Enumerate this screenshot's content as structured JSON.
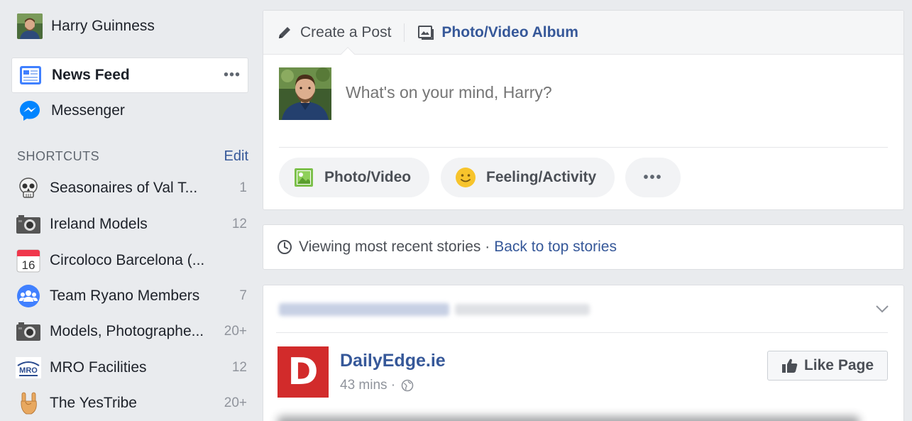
{
  "sidebar": {
    "profile_name": "Harry Guinness",
    "nav": [
      {
        "label": "News Feed",
        "icon": "news-feed-icon"
      },
      {
        "label": "Messenger",
        "icon": "messenger-icon"
      }
    ],
    "more_label": "•••",
    "shortcuts_title": "SHORTCUTS",
    "shortcuts_edit": "Edit",
    "shortcuts": [
      {
        "label": "Seasonaires of Val T...",
        "count": "1",
        "icon": "skull-icon"
      },
      {
        "label": "Ireland Models",
        "count": "12",
        "icon": "camera-icon"
      },
      {
        "label": "Circoloco Barcelona (...",
        "count": "",
        "icon": "calendar-icon",
        "calendar_day": "16"
      },
      {
        "label": "Team Ryano Members",
        "count": "7",
        "icon": "group-icon"
      },
      {
        "label": "Models, Photographe...",
        "count": "20+",
        "icon": "camera-icon"
      },
      {
        "label": "MRO Facilities",
        "count": "12",
        "icon": "mro-logo-icon",
        "logo_text": "MRO"
      },
      {
        "label": "The YesTribe",
        "count": "20+",
        "icon": "rock-hand-icon"
      }
    ]
  },
  "composer": {
    "tab_create": "Create a Post",
    "tab_album": "Photo/Video Album",
    "placeholder": "What's on your mind, Harry?",
    "action_photo": "Photo/Video",
    "action_feeling": "Feeling/Activity",
    "action_more": "•••"
  },
  "recent": {
    "text": "Viewing most recent stories ·",
    "link": "Back to top stories"
  },
  "post": {
    "page_name": "DailyEdge.ie",
    "logo_letter": "D",
    "time": "43 mins ·",
    "like_button": "Like Page"
  },
  "colors": {
    "background": "#e9ebee",
    "link": "#365899",
    "muted": "#90949c",
    "logo_red": "#d22b2b"
  }
}
